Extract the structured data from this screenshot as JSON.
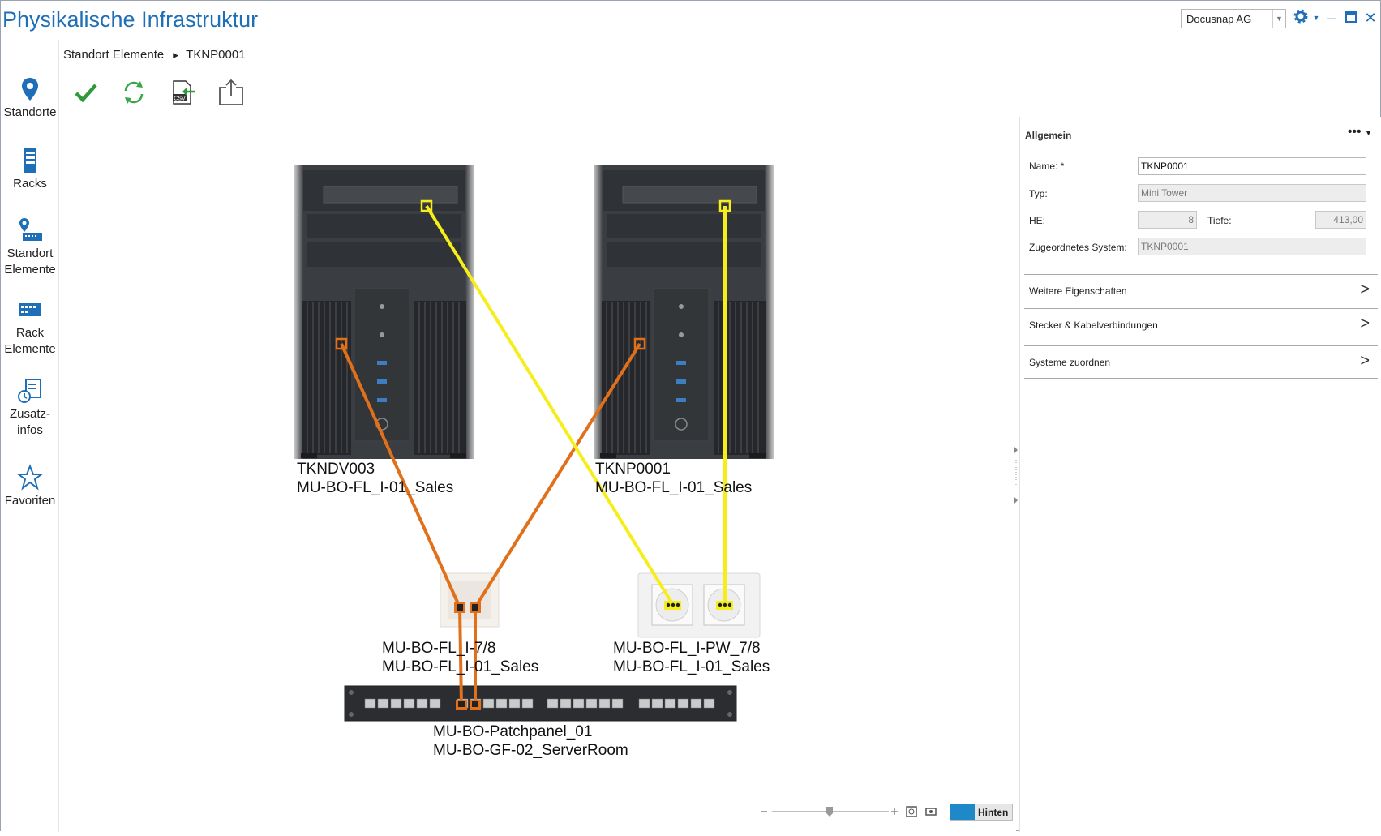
{
  "app": {
    "title": "Physikalische Infrastruktur",
    "company": "Docusnap AG"
  },
  "sidebar": {
    "items": [
      {
        "label": "Standorte",
        "icon": "location-pin-icon"
      },
      {
        "label": "Racks",
        "icon": "rack-icon"
      },
      {
        "label": "Standort Elemente",
        "label1": "Standort",
        "label2": "Elemente",
        "icon": "site-elements-icon"
      },
      {
        "label": "Rack Elemente",
        "label1": "Rack",
        "label2": "Elemente",
        "icon": "rack-elements-icon"
      },
      {
        "label": "Zusatz-infos",
        "label1": "Zusatz-",
        "label2": "infos",
        "icon": "additional-info-icon"
      },
      {
        "label": "Favoriten",
        "icon": "star-icon"
      }
    ]
  },
  "breadcrumb": {
    "parent": "Standort Elemente",
    "current": "TKNP0001"
  },
  "toolbar": {
    "save_icon": "checkmark-icon",
    "refresh_icon": "refresh-icon",
    "csv_icon": "csv-export-icon",
    "share_icon": "share-icon"
  },
  "diagram": {
    "colors": {
      "network_cable": "#e0701a",
      "power_cable": "#f5ee1a"
    },
    "devices": [
      {
        "name": "TKNDV003",
        "location": "MU-BO-FL_I-01_Sales"
      },
      {
        "name": "TKNP0001",
        "location": "MU-BO-FL_I-01_Sales"
      }
    ],
    "network_outlet": {
      "name": "MU-BO-FL_I-7/8",
      "location": "MU-BO-FL_I-01_Sales"
    },
    "power_outlet": {
      "name": "MU-BO-FL_I-PW_7/8",
      "location": "MU-BO-FL_I-01_Sales"
    },
    "patchpanel": {
      "name": "MU-BO-Patchpanel_01",
      "location": "MU-BO-GF-02_ServerRoom"
    }
  },
  "panel": {
    "section_title": "Allgemein",
    "more_label": "•••",
    "fields": {
      "name_label": "Name: *",
      "name_value": "TKNP0001",
      "typ_label": "Typ:",
      "typ_value": "Mini Tower",
      "he_label": "HE:",
      "he_value": "8",
      "tiefe_label": "Tiefe:",
      "tiefe_value": "413,00",
      "system_label": "Zugeordnetes System:",
      "system_value": "TKNP0001"
    },
    "sections": [
      {
        "label": "Weitere Eigenschaften"
      },
      {
        "label": "Stecker & Kabelverbindungen"
      },
      {
        "label": "Systeme zuordnen"
      }
    ]
  },
  "footer": {
    "view_toggle": "Hinten"
  }
}
